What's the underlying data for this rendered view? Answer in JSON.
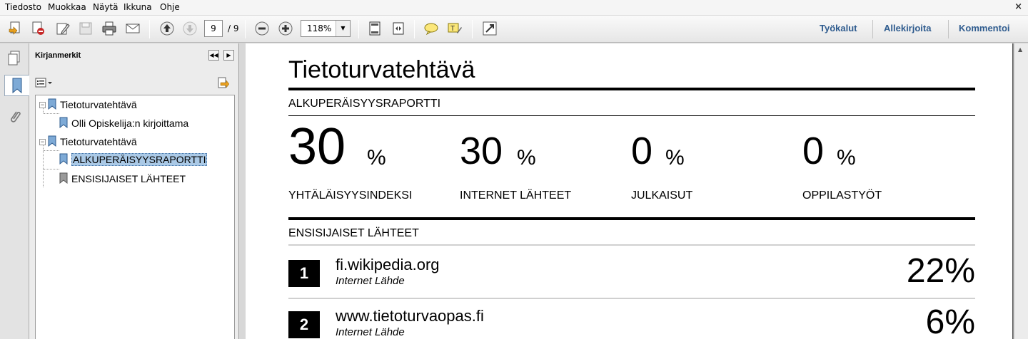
{
  "menu": {
    "items": [
      "Tiedosto",
      "Muokkaa",
      "Näytä",
      "Ikkuna",
      "Ohje"
    ],
    "close": "×"
  },
  "toolbar": {
    "page_current": "9",
    "page_total": "/ 9",
    "zoom": "118%",
    "right_links": [
      "Työkalut",
      "Allekirjoita",
      "Kommentoi"
    ],
    "icons": [
      "create-pdf-icon",
      "export-pdf-icon",
      "edit-icon",
      "save-icon",
      "print-icon",
      "email-icon",
      "prev-page-icon",
      "next-page-icon",
      "zoom-out-icon",
      "zoom-in-icon",
      "fit-page-icon",
      "fit-width-icon",
      "comment-icon",
      "highlight-icon",
      "fullscreen-icon"
    ]
  },
  "sidebar": {
    "title": "Kirjanmerkit",
    "nav_prev": "◀◀",
    "nav_next": "▶",
    "bookmarks": [
      {
        "label": "Tietoturvatehtävä",
        "level": 0
      },
      {
        "label": "Olli Opiskelija:n kirjoittama",
        "level": 1
      },
      {
        "label": "Tietoturvatehtävä",
        "level": 0
      },
      {
        "label": "ALKUPERÄISYYSRAPORTTI",
        "level": 1,
        "selected": true
      },
      {
        "label": "ENSISIJAISET LÄHTEET",
        "level": 1
      }
    ]
  },
  "document": {
    "title": "Tietoturvatehtävä",
    "report_heading": "ALKUPERÄISYYSRAPORTTI",
    "stats": [
      {
        "value": "30",
        "unit": "%",
        "label": "YHTÄLÄISYYSINDEKSI"
      },
      {
        "value": "30",
        "unit": "%",
        "label": "INTERNET LÄHTEET"
      },
      {
        "value": "0",
        "unit": "%",
        "label": "JULKAISUT"
      },
      {
        "value": "0",
        "unit": "%",
        "label": "OPPILASTYÖT"
      }
    ],
    "sources_heading": "ENSISIJAISET LÄHTEET",
    "sources": [
      {
        "rank": "1",
        "name": "fi.wikipedia.org",
        "type": "Internet Lähde",
        "share": "22%"
      },
      {
        "rank": "2",
        "name": "www.tietoturvaopas.fi",
        "type": "Internet Lähde",
        "share": "6%"
      }
    ]
  }
}
